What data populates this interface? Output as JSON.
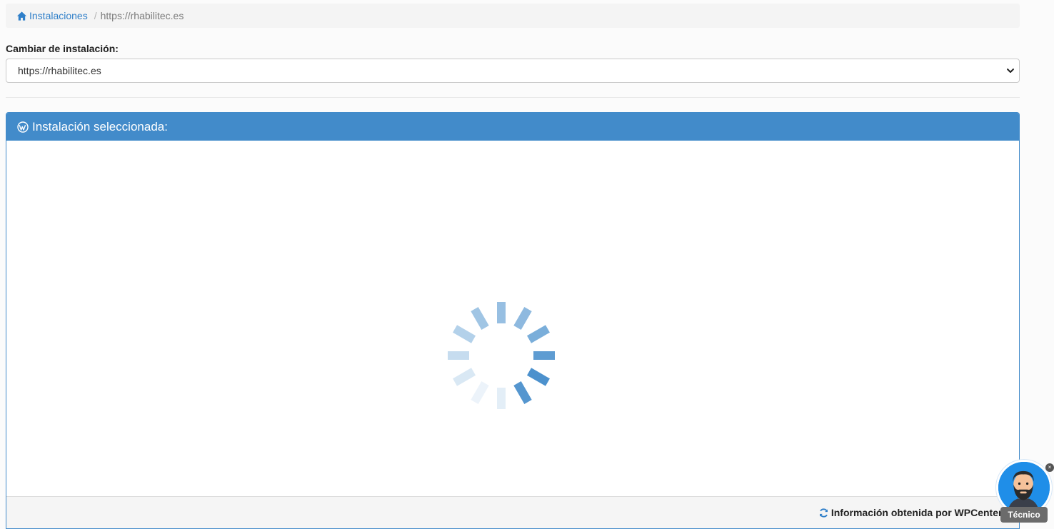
{
  "breadcrumb": {
    "home_label": "Instalaciones",
    "separator": "/",
    "current": "https://rhabilitec.es"
  },
  "installation_select": {
    "label": "Cambiar de instalación:",
    "selected_value": "https://rhabilitec.es"
  },
  "panel": {
    "title": "Instalación seleccionada:",
    "loading": true,
    "footer_text": "Información obtenida por WPCenter el"
  },
  "chat_widget": {
    "label": "Técnico",
    "close_symbol": "×"
  },
  "colors": {
    "accent": "#428bca",
    "link": "#2f7fc9",
    "footer_bg": "#f5f5f5"
  },
  "icons": {
    "breadcrumb_home": "home-icon",
    "panel_heading": "wordpress-icon",
    "footer": "refresh-icon",
    "select": "chevron-down-icon",
    "loading": "spinner-icon"
  }
}
